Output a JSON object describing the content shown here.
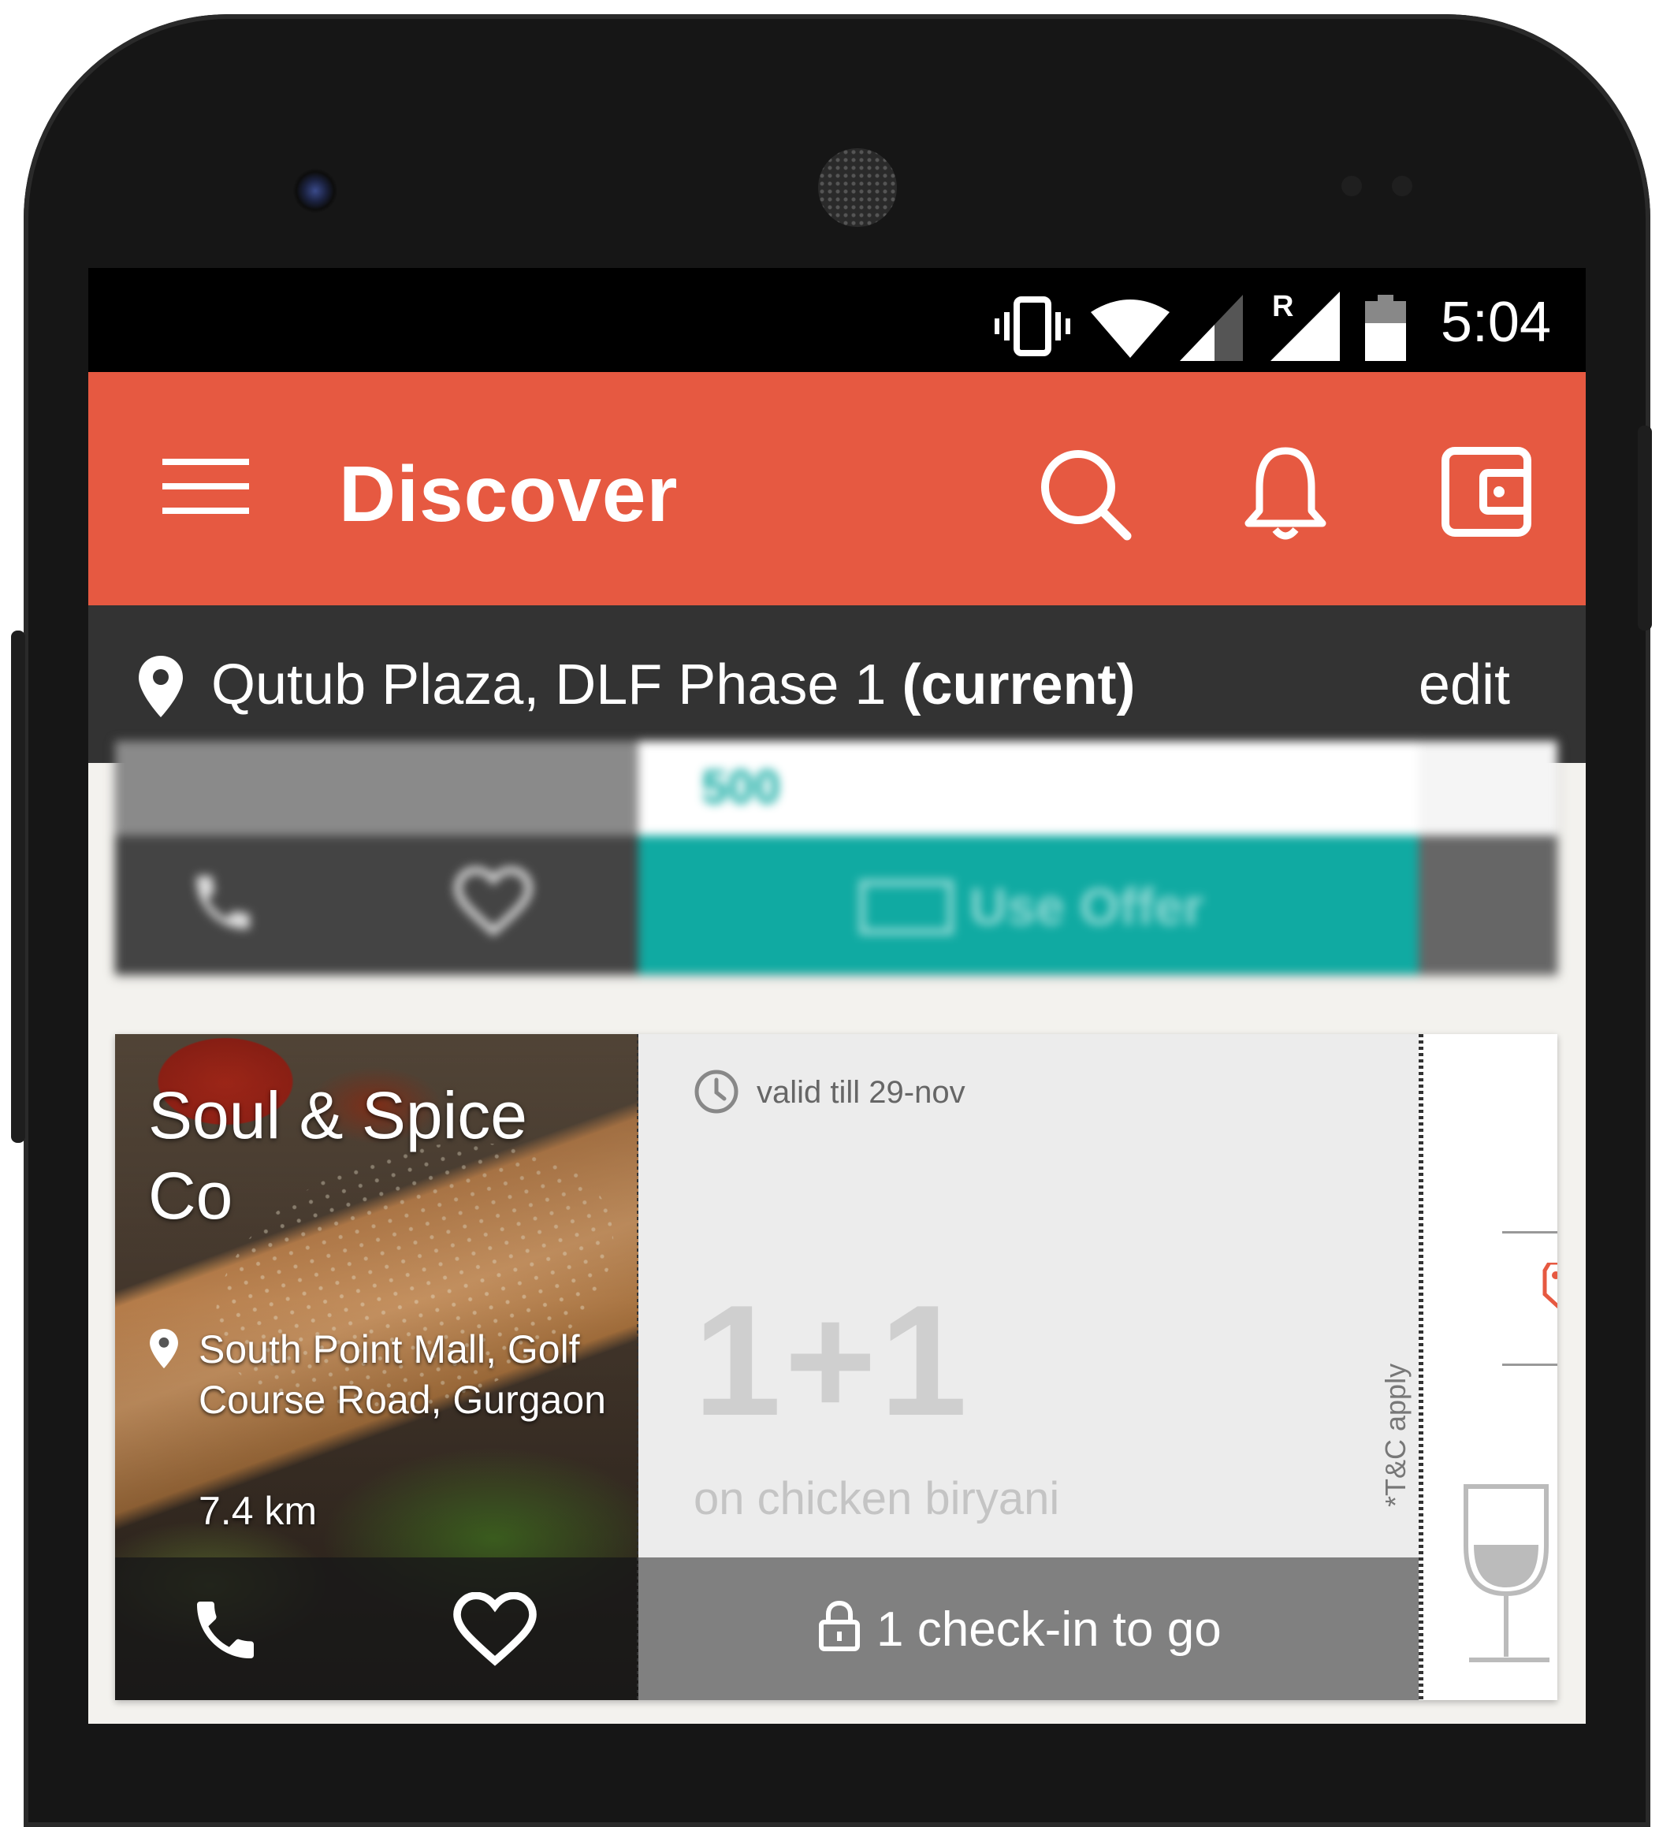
{
  "status_bar": {
    "time": "5:04",
    "icons": [
      "vibrate-icon",
      "wifi-icon",
      "signal-icon",
      "roaming-signal-icon",
      "battery-icon"
    ],
    "roaming_label": "R"
  },
  "app_bar": {
    "title": "Discover",
    "icons": [
      "menu-icon",
      "search-icon",
      "bell-icon",
      "wallet-icon"
    ],
    "color": "#e65941"
  },
  "location_bar": {
    "location": "Qutub Plaza, DLF Phase 1 ",
    "current_label": "(current)",
    "edit_label": "edit"
  },
  "cards": [
    {
      "blurred": true,
      "offer_value": "500",
      "button_label": "Use Offer",
      "teal": "#10aaa2"
    },
    {
      "venue_name": "Soul & Spice Co",
      "address": "South Point Mall, Golf Course Road, Gurgaon",
      "distance": "7.4 km",
      "validity": "valid till 29-nov",
      "deal": "1+1",
      "deal_description": "on chicken biryani",
      "terms": "*T&C apply",
      "action_label": "1 check-in to go"
    }
  ]
}
